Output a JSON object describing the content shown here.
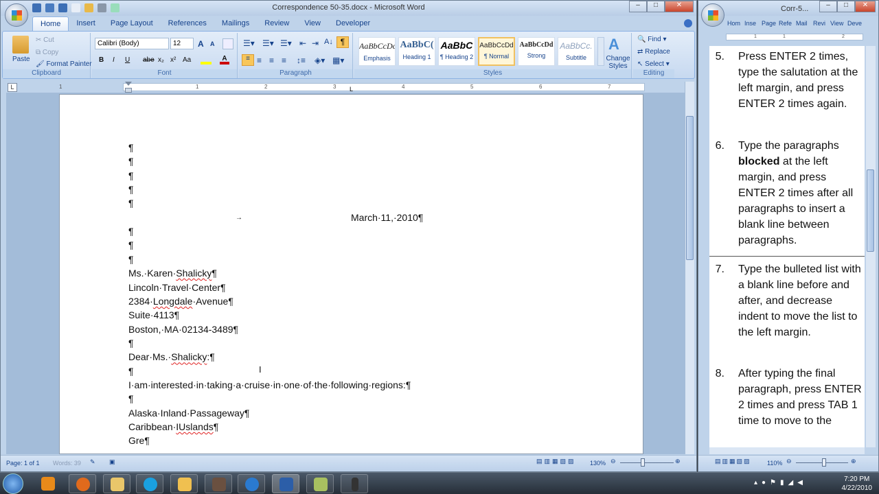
{
  "word": {
    "title": "Correspondence 50-35.docx - Microsoft Word",
    "tabs": [
      "Home",
      "Insert",
      "Page Layout",
      "References",
      "Mailings",
      "Review",
      "View",
      "Developer"
    ],
    "clipboard": {
      "paste": "Paste",
      "cut": "Cut",
      "copy": "Copy",
      "format_painter": "Format Painter",
      "label": "Clipboard"
    },
    "font": {
      "name": "Calibri (Body)",
      "size": "12",
      "label": "Font",
      "bold": "B",
      "italic": "I",
      "underline": "U",
      "strike": "abe",
      "sub": "x₂",
      "sup": "x²",
      "case": "Aa",
      "grow": "A",
      "shrink": "A"
    },
    "paragraph": {
      "label": "Paragraph",
      "pilcrow": "¶"
    },
    "styles": {
      "label": "Styles",
      "items": [
        {
          "preview": "AaBbCcDc",
          "name": "Emphasis"
        },
        {
          "preview": "AaBbC(",
          "name": "Heading 1"
        },
        {
          "preview": "AaBbC",
          "name": "¶ Heading 2"
        },
        {
          "preview": "AaBbCcDd",
          "name": "¶ Normal"
        },
        {
          "preview": "AaBbCcDd",
          "name": "Strong"
        },
        {
          "preview": "AaBbCc.",
          "name": "Subtitle"
        }
      ],
      "change": "Change Styles"
    },
    "editing": {
      "label": "Editing",
      "find": "Find",
      "replace": "Replace",
      "select": "Select"
    },
    "ruler_numbers": [
      "1",
      "1",
      "2",
      "3",
      "4",
      "5",
      "6",
      "7"
    ],
    "document": {
      "lines": [
        "¶",
        "¶",
        "¶",
        "¶",
        "¶"
      ],
      "date": "March·11,·2010¶",
      "lines2": [
        "¶",
        "¶",
        "¶"
      ],
      "address": [
        {
          "a": "Ms.·Karen·",
          "s": "Shalicky",
          "b": "¶"
        },
        {
          "a": "Lincoln·Travel·Center¶",
          "s": "",
          "b": ""
        },
        {
          "a": "2384·",
          "s": "Longdale",
          "b": "·Avenue¶"
        },
        {
          "a": "Suite·4113¶",
          "s": "",
          "b": ""
        },
        {
          "a": "Boston,·MA·02134-3489¶",
          "s": "",
          "b": ""
        },
        {
          "a": "¶",
          "s": "",
          "b": ""
        },
        {
          "a": "Dear·Ms.·",
          "s": "Shalicky",
          "b": ":¶"
        },
        {
          "a": "¶",
          "s": "",
          "b": ""
        },
        {
          "a": "I·am·interested·in·taking·a·cruise·in·one·of·the·following·regions:¶",
          "s": "",
          "b": ""
        },
        {
          "a": "¶",
          "s": "",
          "b": ""
        },
        {
          "a": "Alaska·Inland·Passageway¶",
          "s": "",
          "b": ""
        },
        {
          "a": "Caribbean·",
          "s": "IUslands",
          "b": "¶"
        },
        {
          "a": "Gre¶",
          "s": "",
          "b": ""
        }
      ]
    },
    "status": {
      "page": "Page: 1 of 1",
      "words": "Words: 39",
      "zoom": "130%"
    }
  },
  "right": {
    "title": "Corr-5...",
    "tabs": [
      "Hom",
      "Inse",
      "Page",
      "Refe",
      "Mail",
      "Revi",
      "View",
      "Deve"
    ],
    "ruler_numbers": [
      "1",
      "1",
      "2"
    ],
    "items": [
      {
        "n": "5.",
        "text": "Press ENTER 2 times, type the salutation at the left margin, and press ENTER 2 times again."
      },
      {
        "n": "6.",
        "pre": "Type the paragraphs ",
        "bold": "blocked",
        "post": " at the left margin, and press ENTER 2 times after all paragraphs to insert a blank line between paragraphs."
      },
      {
        "n": "7.",
        "text": "Type the bulleted list with a blank line before and after, and decrease indent to move the list to the left margin."
      },
      {
        "n": "8.",
        "text": "After typing the final paragraph, press ENTER 2 times and press TAB 1 time to move to the"
      }
    ],
    "zoom": "110%"
  },
  "taskbar": {
    "time": "7:20 PM",
    "date": "4/22/2010"
  }
}
